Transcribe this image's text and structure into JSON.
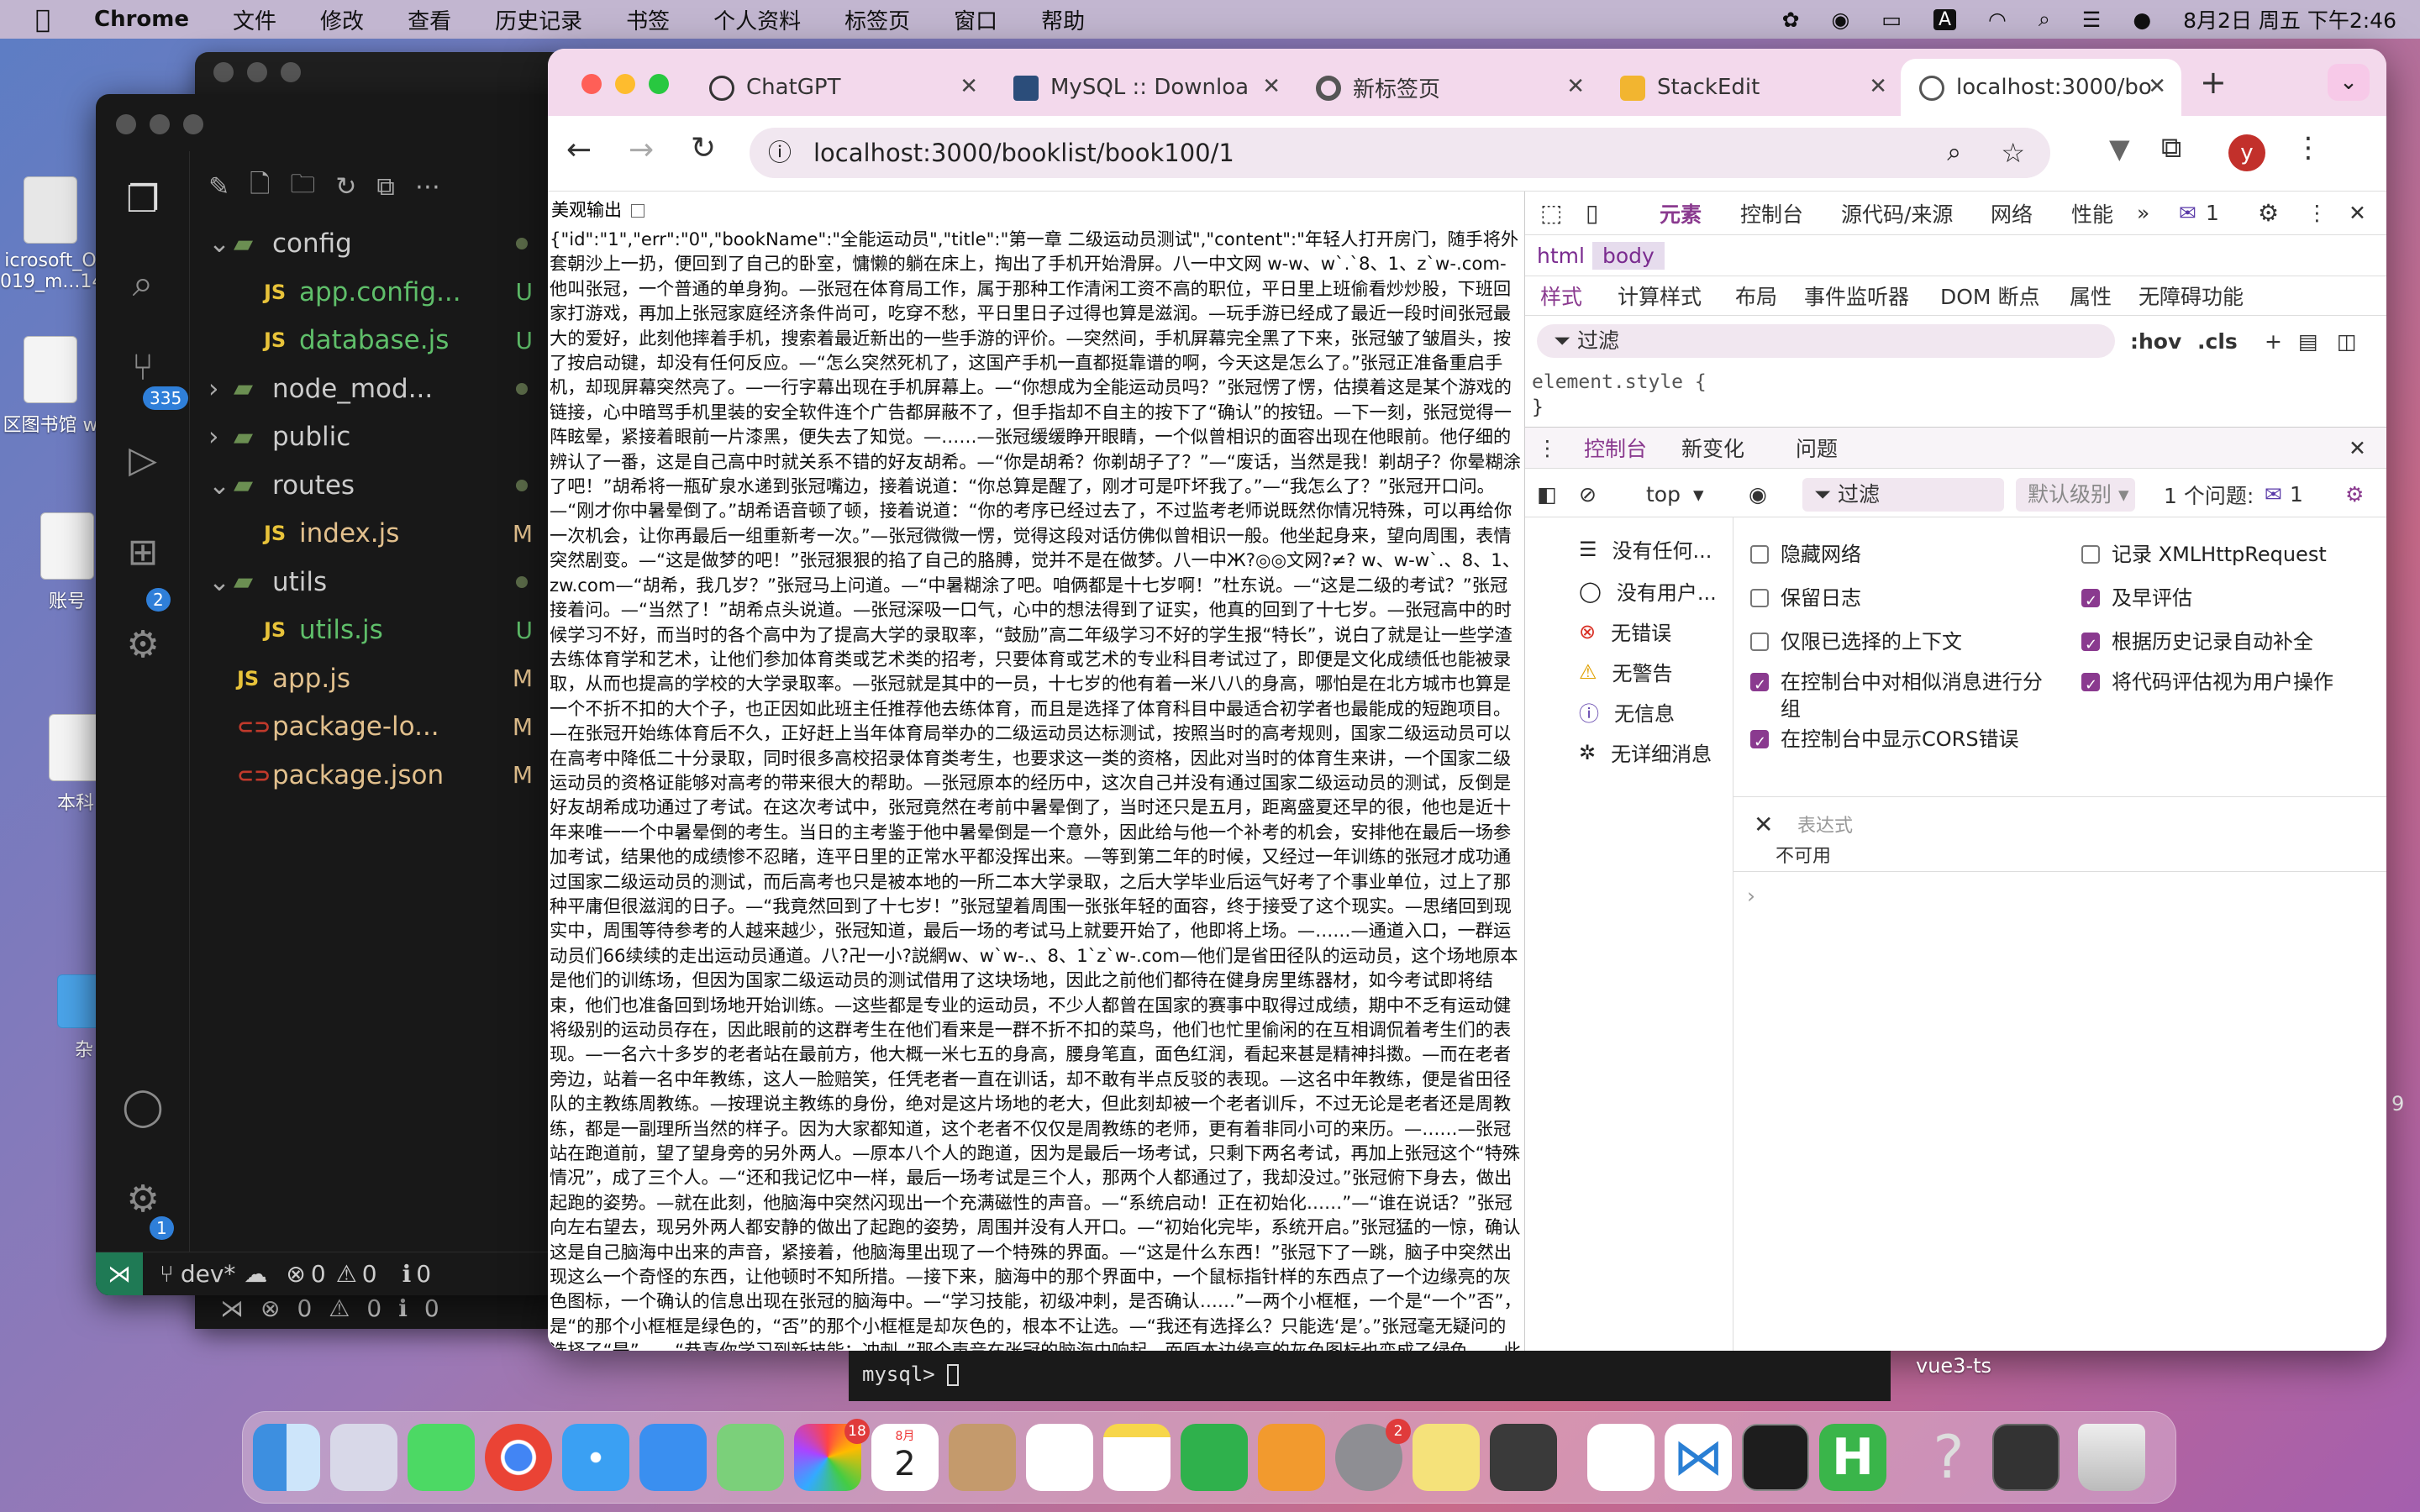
{
  "menubar": {
    "app_name": "Chrome",
    "items": [
      "文件",
      "修改",
      "查看",
      "历史记录",
      "书签",
      "个人资料",
      "标签页",
      "窗口",
      "帮助"
    ],
    "input_method": "A",
    "datetime": "8月2日 周五 下午2:46"
  },
  "desktop": {
    "icons": [
      {
        "label": "icrosoft_O\n019_m...14"
      },
      {
        "label": "区图书馆 w"
      },
      {
        "label": "账号"
      },
      {
        "label": "本科"
      },
      {
        "label": "杂"
      }
    ],
    "side_digit": "9",
    "folder_label": "vue3-ts"
  },
  "vscode": {
    "tree": [
      {
        "name": "config",
        "type": "folder",
        "expanded": true,
        "status": "dot"
      },
      {
        "name": "app.config...",
        "type": "file",
        "status": "U"
      },
      {
        "name": "database.js",
        "type": "file",
        "status": "U"
      },
      {
        "name": "node_mod...",
        "type": "folder",
        "expanded": false,
        "status": "dot"
      },
      {
        "name": "public",
        "type": "folder",
        "expanded": false,
        "status": ""
      },
      {
        "name": "routes",
        "type": "folder",
        "expanded": true,
        "status": "dot"
      },
      {
        "name": "index.js",
        "type": "file",
        "status": "M"
      },
      {
        "name": "utils",
        "type": "folder",
        "expanded": true,
        "status": "dot"
      },
      {
        "name": "utils.js",
        "type": "file",
        "status": "U"
      },
      {
        "name": "app.js",
        "type": "file",
        "status": "M"
      },
      {
        "name": "package-lo...",
        "type": "file",
        "status": "M"
      },
      {
        "name": "package.json",
        "type": "file",
        "status": "M"
      }
    ],
    "badges": {
      "scm": "335",
      "extensions": "2",
      "settings": "1"
    },
    "status": {
      "branch": "dev*",
      "errors": "0",
      "warnings": "0",
      "ports": "0",
      "back_errors": "0",
      "back_warnings": "0",
      "back_ports": "0"
    }
  },
  "chrome": {
    "tabs": [
      {
        "title": "ChatGPT",
        "active": false
      },
      {
        "title": "MySQL :: Downloa",
        "active": false
      },
      {
        "title": "新标签页",
        "active": false
      },
      {
        "title": "StackEdit",
        "active": false
      },
      {
        "title": "localhost:3000/bo",
        "active": true
      }
    ],
    "url": "localhost:3000/booklist/book100/1",
    "profile_initial": "y",
    "pretty_print_label": "美观输出",
    "json_text": "{\"id\":\"1\",\"err\":\"0\",\"bookName\":\"全能运动员\",\"title\":\"第一章 二级运动员测试\",\"content\":\"年轻人打开房门，随手将外套朝沙上一扔，便回到了自己的卧室，慵懒的躺在床上，掏出了手机开始滑屏。八一中文网 w-w、w`.`8、1、z`w-.com-他叫张冠，一个普通的单身狗。—张冠在体育局工作，属于那种工作清闲工资不高的职位，平日里上班偷看炒炒股，下班回家打游戏，再加上张冠家庭经济条件尚可，吃穿不愁，平日里日子过得也算是滋润。—玩手游已经成了最近一段时间张冠最大的爱好，此刻他摔着手机，搜索着最近新出的一些手游的评价。—突然间，手机屏幕完全黑了下来，张冠皱了皱眉头，按了按启动键，却没有任何反应。—“怎么突然死机了，这国产手机一直都挺靠谱的啊，今天这是怎么了。”张冠正准备重启手机，却现屏幕突然亮了。—一行字幕出现在手机屏幕上。—“你想成为全能运动员吗？”张冠愣了愣，估摸着这是某个游戏的链接，心中暗骂手机里装的安全软件连个广告都屏蔽不了，但手指却不自主的按下了“确认”的按钮。—下一刻，张冠觉得一阵眩晕，紧接着眼前一片漆黑，便失去了知觉。—……—张冠缓缓睁开眼睛，一个似曾相识的面容出现在他眼前。他仔细的辨认了一番，这是自己高中时就关系不错的好友胡希。—“你是胡希？你剃胡子了？”—“废话，当然是我！剃胡子？你晕糊涂了吧！”胡希将一瓶矿泉水递到张冠嘴边，接着说道：“你总算是醒了，刚才可是吓坏我了。”—“我怎么了？”张冠开口问。—“刚才你中暑晕倒了。”胡希语音顿了顿，接着说道：“你的考序已经过去了，不过监考老师说既然你情况特殊，可以再给你一次机会，让你再最后一组重新考一次。”—张冠微微一愣，觉得这段对话仿佛似曾相识一般。他坐起身来，望向周围，表情突然剧变。—“这是做梦的吧！”张冠狠狠的掐了自己的胳膊，觉并不是在做梦。八一中Ж?◎◎文网?≠? w、w-w`.、8、1、zw.com—“胡希，我几岁？”张冠马上问道。—“中暑糊涂了吧。咱俩都是十七岁啊！”杜东说。—“这是二级的考试？”张冠接着问。—“当然了！”胡希点头说道。—张冠深吸一口气，心中的想法得到了证实，他真的回到了十七岁。—张冠高中的时候学习不好，而当时的各个高中为了提高大学的录取率，“鼓励”高二年级学习不好的学生报“特长”，说白了就是让一些学渣去练体育学和艺术，让他们参加体育类或艺术类的招考，只要体育或艺术的专业科目考试过了，即便是文化成绩低也能被录取，从而也提高的学校的大学录取率。—张冠就是其中的一员，十七岁的他有着一米八八的身高，哪怕是在北方城市也算是一个不折不扣的大个子，也正因如此班主任推荐他去练体育，而且是选择了体育科目中最适合初学者也最能成的短跑项目。—在张冠开始练体育后不久，正好赶上当年体育局举办的二级运动员达标测试，按照当时的高考规则，国家二级运动员可以在高考中降低二十分录取，同时很多高校招录体育类考生，也要求这一类的资格，因此对当时的体育生来讲，一个国家二级运动员的资格证能够对高考的带来很大的帮助。—张冠原本的经历中，这次自己并没有通过国家二级运动员的测试，反倒是好友胡希成功通过了考试。在这次考试中，张冠竟然在考前中暑晕倒了，当时还只是五月，距离盛夏还早的很，他也是近十年来唯一一个中暑晕倒的考生。当日的主考鉴于他中暑晕倒是一个意外，因此给与他一个补考的机会，安排他在最后一场参加考试，结果他的成绩惨不忍睹，连平日里的正常水平都没挥出来。—等到第二年的时候，又经过一年训练的张冠才成功通过国家二级运动员的测试，而后高考也只是被本地的一所二本大学录取，之后大学毕业后运气好考了个事业单位，过上了那种平庸但很滋润的日子。—“我竟然回到了十七岁！”张冠望着周围一张张年轻的面容，终于接受了这个现实。—思绪回到现实中，周围等待参考的人越来越少，张冠知道，最后一场的考试马上就要开始了，他即将上场。—……—通道入口，一群运动员们66续续的走出运动员通道。八?卍一小?説網w、w`w-.、8、1`z`w-.com—他们是省田径队的运动员，这个场地原本是他们的训练场，但因为国家二级运动员的测试借用了这块场地，因此之前他们都待在健身房里练器材，如今考试即将结束，他们也准备回到场地开始训练。—这些都是专业的运动员，不少人都曾在国家的赛事中取得过成绩，期中不乏有运动健将级别的运动员存在，因此眼前的这群考生在他们看来是一群不折不扣的菜鸟，他们也忙里偷闲的在互相调侃着考生们的表现。—一名六十多岁的老者站在最前方，他大概一米七五的身高，腰身笔直，面色红润，看起来甚是精神抖擞。—而在老者旁边，站着一名中年教练，这人一脸赔笑，任凭老者一直在训话，却不敢有半点反驳的表现。—这名中年教练，便是省田径队的主教练周教练。—按理说主教练的身份，绝对是这片场地的老大，但此刻却被一个老者训斥，不过无论是老者还是周教练，都是一副理所当然的样子。因为大家都知道，这个老者不仅仅是周教练的老师，更有着非同小可的来历。—……—张冠站在跑道前，望了望身旁的另外两人。—原本八个人的跑道，因为是最后一场考试，只剩下两名考试，再加上张冠这个“特殊情况”，成了三个人。—“还和我记忆中一样，最后一场考试是三个人，那两个人都通过了，我却没过。”张冠俯下身去，做出起跑的姿势。—就在此刻，他脑海中突然闪现出一个充满磁性的声音。—“系统启动！正在初始化……”—“谁在说话？”张冠向左右望去，现另外两人都安静的做出了起跑的姿势，周围并没有人开口。—“初始化完毕，系统开启。”张冠猛的一惊，确认这是自己脑海中出来的声音，紧接着，他脑海里出现了一个特殊的界面。—“这是什么东西！”张冠下了一跳，脑子中突然出现这么一个奇怪的东西，让他顿时不知所措。—接下来，脑海中的那个界面中，一个鼠标指针样的东西点了一个边缘亮的灰色图标，一个确认的信息出现在张冠的脑海中。—“学习技能，初级冲刺，是否确认……”—两个小框框，一个是“一个”否”，是“的那个小框框是绿色的，“否”的那个小框框是却灰色的，根本不让选。—“我还有选择么？只能选‘是’。”张冠毫无疑问的选择了“是”。—“恭喜你学习到新技能：冲刺。”那个声音在张冠的脑海中响起。而原本边缘亮的灰色图标也变成了绿色。—此刻，那鼠标指针样子的东西正好指在“冲刺”的绿色图标上，几行马上出现。—“冲刺”技能效果：直"
  },
  "devtools": {
    "tabs": [
      "元素",
      "控制台",
      "源代码/来源",
      "网络",
      "性能"
    ],
    "issues_badge": "1",
    "breadcrumb": [
      "html",
      "body"
    ],
    "styles_tabs": [
      "样式",
      "计算样式",
      "布局",
      "事件监听器",
      "DOM 断点",
      "属性",
      "无障碍功能"
    ],
    "filter_placeholder": "过滤",
    "hov": ":hov",
    "cls": ".cls",
    "element_style_line1": "element.style {",
    "element_style_line2": "}",
    "drawer_tabs": [
      "控制台",
      "新变化",
      "问题"
    ],
    "context": "top",
    "console_filter": "过滤",
    "default_level": "默认级别",
    "issues_count": "1 个问题:",
    "issues_num": "1",
    "sidebar": [
      "没有任何...",
      "没有用户...",
      "无错误",
      "无警告",
      "无信息",
      "无详细消息"
    ],
    "options_left": [
      {
        "label": "隐藏网络",
        "checked": false
      },
      {
        "label": "保留日志",
        "checked": false
      },
      {
        "label": "仅限已选择的上下文",
        "checked": false
      },
      {
        "label": "在控制台中对相似消息进行分组",
        "checked": true
      },
      {
        "label": "在控制台中显示CORS错误",
        "checked": true
      }
    ],
    "options_right": [
      {
        "label": "记录 XMLHttpRequest",
        "checked": false
      },
      {
        "label": "及早评估",
        "checked": true
      },
      {
        "label": "根据历史记录自动补全",
        "checked": true
      },
      {
        "label": "将代码评估视为用户操作",
        "checked": true
      }
    ],
    "expression_label": "表达式",
    "expression_value": "不可用"
  },
  "terminal": {
    "prompt": "mysql> "
  },
  "dock": {
    "badges": {
      "photos": "18",
      "settings": "2"
    },
    "calendar_month": "8月",
    "calendar_day": "2"
  }
}
